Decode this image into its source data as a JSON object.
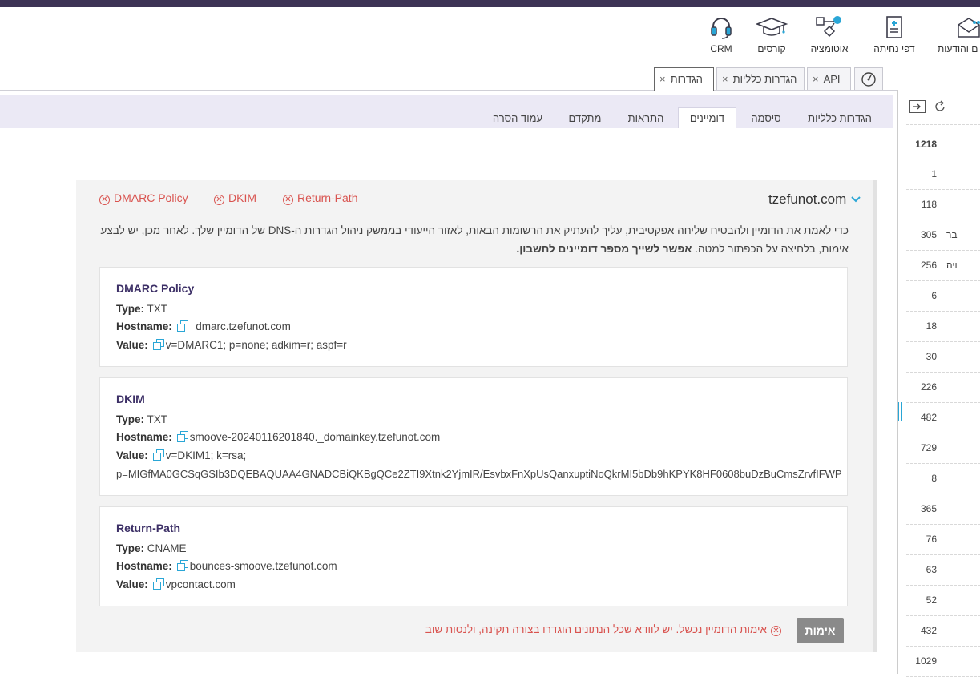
{
  "nav": {
    "items": [
      {
        "label": "CRM",
        "icon": "headset-icon"
      },
      {
        "label": "קורסים",
        "icon": "graduation-cap-icon"
      },
      {
        "label": "אוטומציה",
        "icon": "automation-icon"
      },
      {
        "label": "דפי נחיתה",
        "icon": "landing-page-icon"
      },
      {
        "label": "ם והודעות",
        "icon": "envelope-icon"
      }
    ]
  },
  "tabs": {
    "settings": "הגדרות",
    "general": "הגדרות כלליות",
    "api": "API",
    "close": "×"
  },
  "subtabs": [
    "הגדרות כלליות",
    "סיסמה",
    "דומיינים",
    "התראות",
    "מתקדם",
    "עמוד הסרה"
  ],
  "sidebar": {
    "numbers": [
      "1218",
      "1",
      "118",
      "305",
      "256",
      "6",
      "18",
      "30",
      "226",
      "482",
      "729",
      "8",
      "365",
      "76",
      "63",
      "52",
      "432",
      "1029"
    ],
    "fragments": [
      "בר",
      "ויה"
    ]
  },
  "domain": {
    "name": "tzefunot.com",
    "status_items": [
      "Return-Path",
      "DKIM",
      "DMARC Policy"
    ],
    "instructions_line1": "כדי לאמת את הדומיין ולהבטיח שליחה אפקטיבית, עליך להעתיק את הרשומות הבאות, לאזור הייעודי בממשק ניהול הגדרות ה-DNS של הדומיין שלך. לאחר מכן, יש לבצע",
    "instructions_line2_plain": "אימות, בלחיצה על הכפתור למטה.",
    "instructions_line2_bold": "אפשר לשייך מספר דומיינים לחשבון."
  },
  "labels": {
    "type": "Type:",
    "hostname": "Hostname:",
    "value": "Value:"
  },
  "records": [
    {
      "title": "DMARC Policy",
      "type": "TXT",
      "hostname": "_dmarc.tzefunot.com",
      "value": "v=DMARC1; p=none; adkim=r; aspf=r",
      "value2": ""
    },
    {
      "title": "DKIM",
      "type": "TXT",
      "hostname": "smoove-20240116201840._domainkey.tzefunot.com",
      "value": "v=DKIM1; k=rsa;",
      "value2": "p=MIGfMA0GCSqGSIb3DQEBAQUAA4GNADCBiQKBgQCe2ZTI9Xtnk2YjmIR/EsvbxFnXpUsQanxuptiNoQkrMI5bDb9hKPYK8HF0608buDzBuCmsZrvfIFWP"
    },
    {
      "title": "Return-Path",
      "type": "CNAME",
      "hostname": "bounces-smoove.tzefunot.com",
      "value": "vpcontact.com",
      "value2": ""
    }
  ],
  "verify": {
    "button": "אימות",
    "error": "אימות הדומיין נכשל. יש לוודא שכל הנתונים הוגדרו בצורה תקינה, ולנסות שוב"
  },
  "colors": {
    "accent": "#3d3355",
    "error": "#d9534f",
    "link": "#2aa6d6"
  }
}
